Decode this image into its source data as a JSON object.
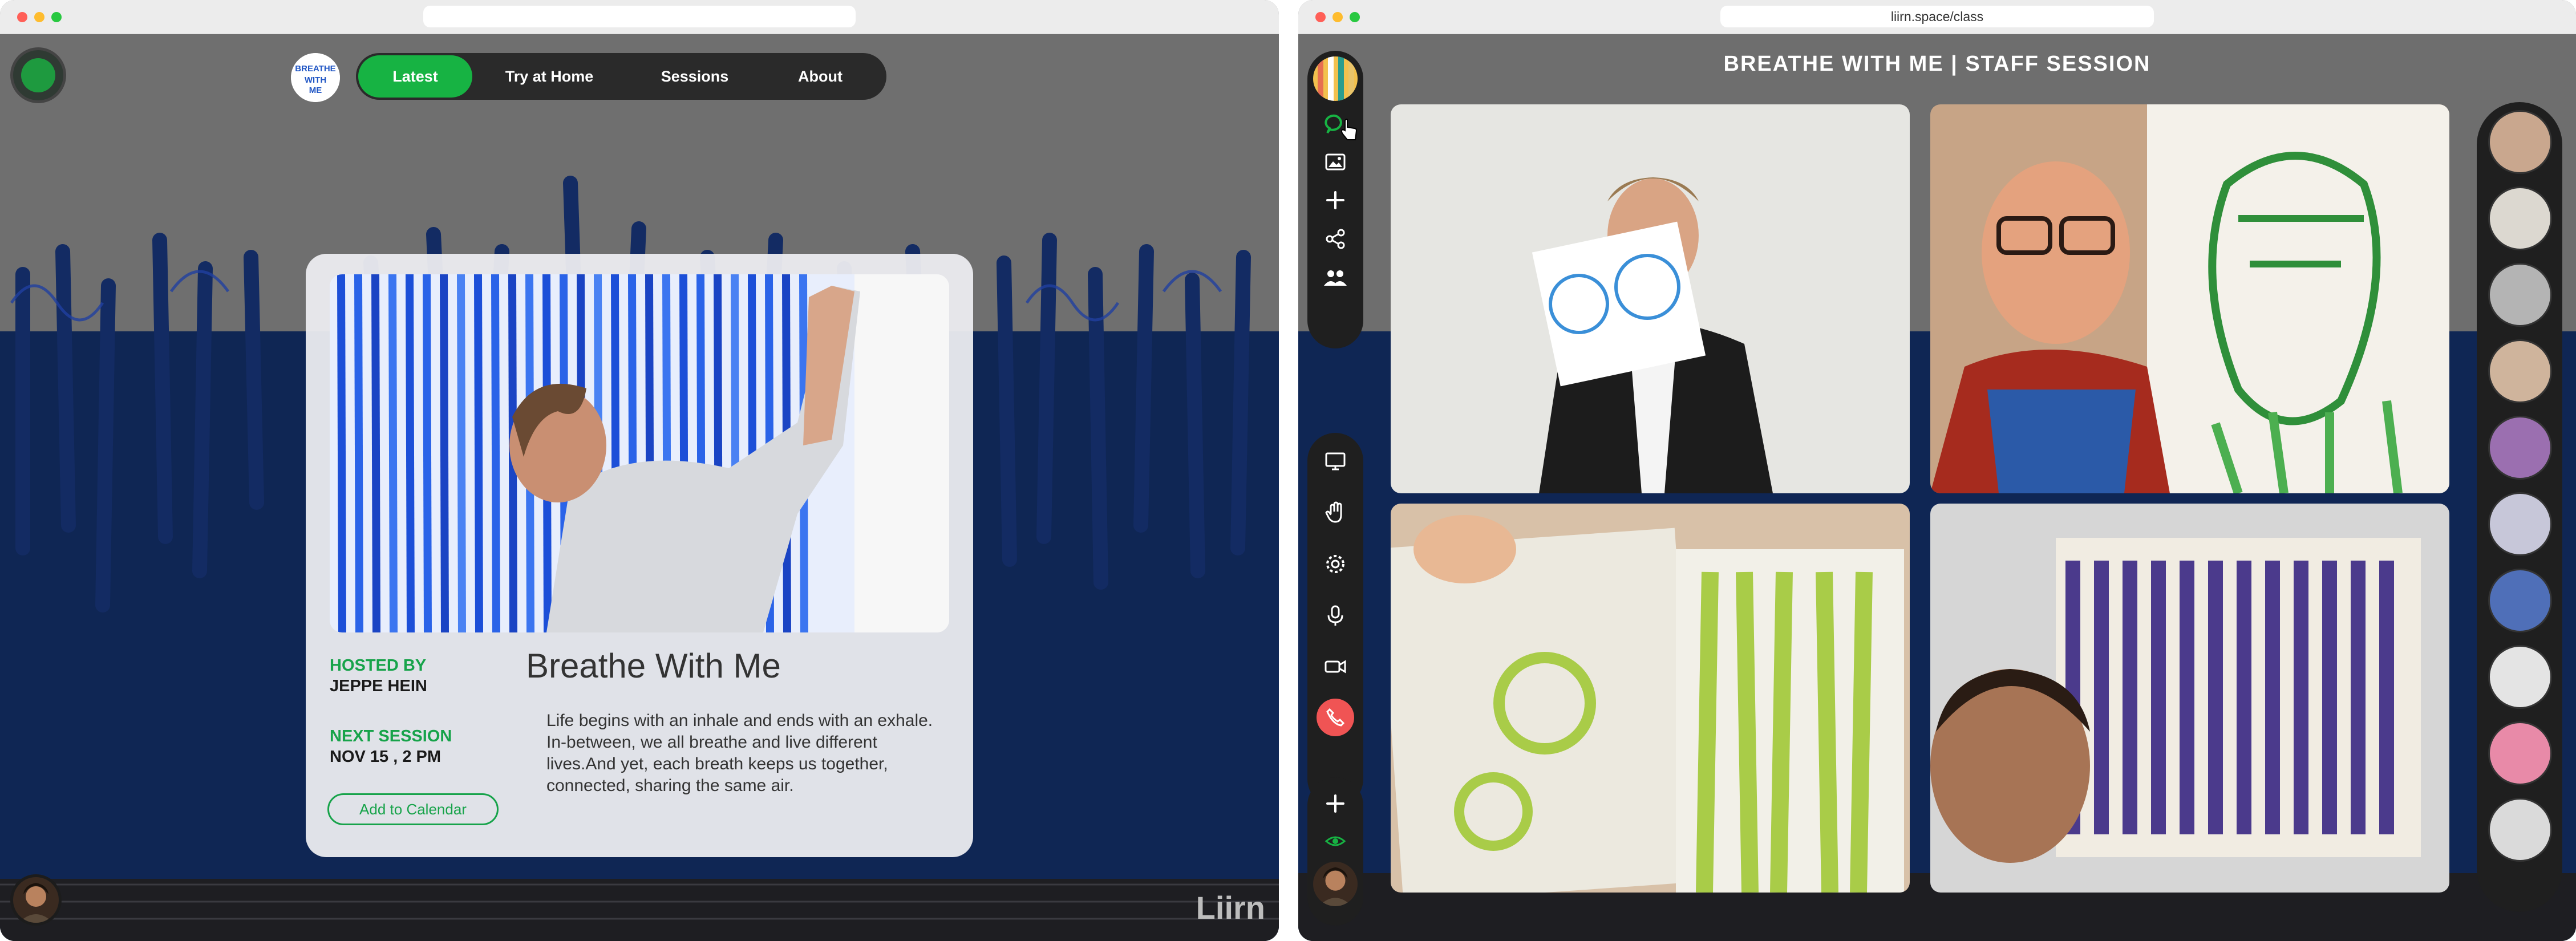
{
  "left_window": {
    "url": "",
    "nav": {
      "badge_text": "BREATHE WITH ME",
      "items": [
        {
          "label": "Latest",
          "active": true
        },
        {
          "label": "Try at Home",
          "active": false
        },
        {
          "label": "Sessions",
          "active": false
        },
        {
          "label": "About",
          "active": false
        }
      ]
    },
    "card": {
      "hosted_by_label": "HOSTED BY",
      "host": "JEPPE HEIN",
      "next_session_label": "NEXT SESSION",
      "next_session": "NOV 15 , 2 PM",
      "title": "Breathe With Me",
      "description": "Life begins with an inhale and ends with an exhale. In-between, we all breathe and live different lives.And yet, each breath keeps us together, connected, sharing the same air.",
      "calendar_button": "Add to Calendar"
    },
    "brand": "Liirn"
  },
  "right_window": {
    "url": "liirn.space/class",
    "session_title": "BREATHE WITH ME | STAFF SESSION",
    "toolbar_icons": [
      "chat-icon",
      "image-icon",
      "plus-icon",
      "share-icon",
      "people-icon"
    ],
    "controls": [
      "screen-share-icon",
      "raise-hand-icon",
      "settings-icon",
      "microphone-icon",
      "camera-icon",
      "end-call-icon"
    ],
    "participant_count": 11
  },
  "colors": {
    "accent_green": "#17b343",
    "card_bg": "#ececf0",
    "dark_bar": "#1f1f1f",
    "end_call_red": "#f05454",
    "navy_paint": "#0f2654"
  }
}
